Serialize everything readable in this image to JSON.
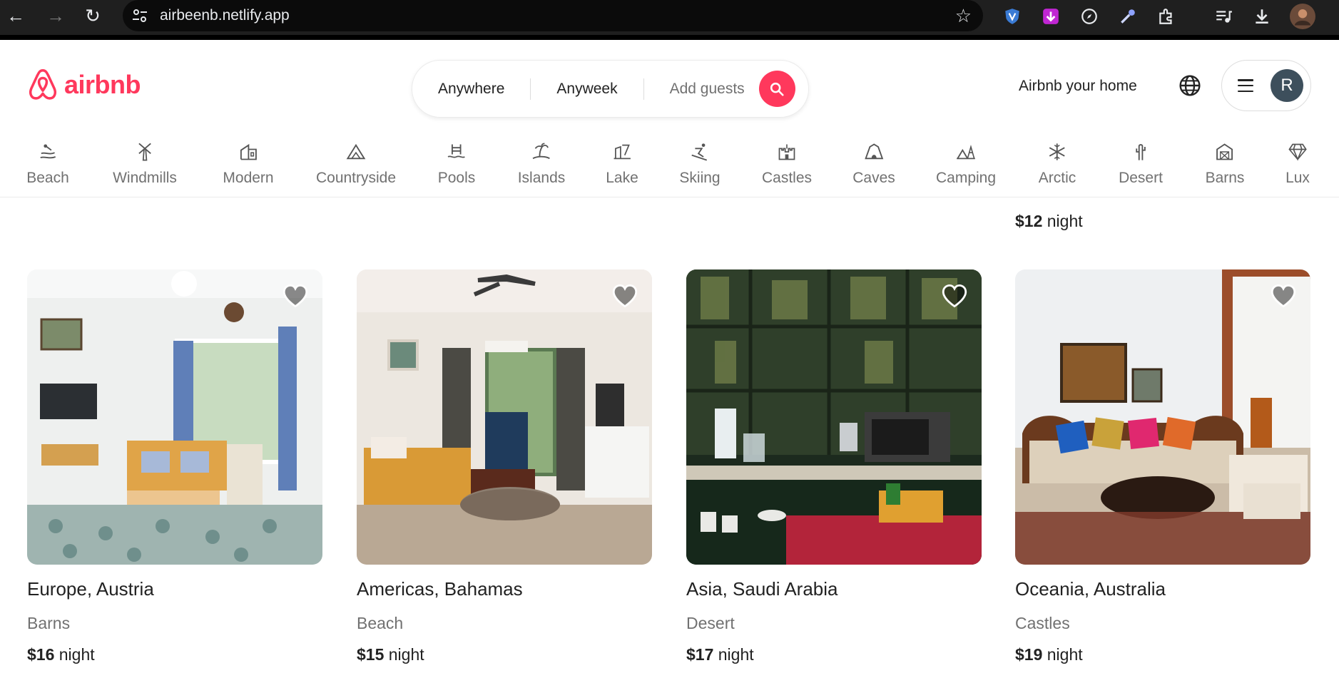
{
  "browser": {
    "url": "airbeenb.netlify.app"
  },
  "header": {
    "brand": "airbnb",
    "search": {
      "where": "Anywhere",
      "when": "Anyweek",
      "guests": "Add guests"
    },
    "host_link": "Airbnb your home",
    "avatar_initial": "R"
  },
  "categories": [
    {
      "label": "Beach",
      "icon": "beach-icon"
    },
    {
      "label": "Windmills",
      "icon": "windmill-icon"
    },
    {
      "label": "Modern",
      "icon": "modern-house-icon"
    },
    {
      "label": "Countryside",
      "icon": "countryside-icon"
    },
    {
      "label": "Pools",
      "icon": "pool-icon"
    },
    {
      "label": "Islands",
      "icon": "island-icon"
    },
    {
      "label": "Lake",
      "icon": "lake-icon"
    },
    {
      "label": "Skiing",
      "icon": "skiing-icon"
    },
    {
      "label": "Castles",
      "icon": "castle-icon"
    },
    {
      "label": "Caves",
      "icon": "cave-icon"
    },
    {
      "label": "Camping",
      "icon": "camping-icon"
    },
    {
      "label": "Arctic",
      "icon": "snowflake-icon"
    },
    {
      "label": "Desert",
      "icon": "cactus-icon"
    },
    {
      "label": "Barns",
      "icon": "barn-icon"
    },
    {
      "label": "Lux",
      "icon": "diamond-icon"
    }
  ],
  "partial_row": {
    "last_price": "$12",
    "night_label": "night"
  },
  "listings": [
    {
      "title": "Europe, Austria",
      "category": "Barns",
      "price": "$16",
      "unit": "night"
    },
    {
      "title": "Americas, Bahamas",
      "category": "Beach",
      "price": "$15",
      "unit": "night"
    },
    {
      "title": "Asia, Saudi Arabia",
      "category": "Desert",
      "price": "$17",
      "unit": "night"
    },
    {
      "title": "Oceania, Australia",
      "category": "Castles",
      "price": "$19",
      "unit": "night"
    }
  ],
  "colors": {
    "brand": "#ff385c",
    "muted": "#717171",
    "text": "#222222"
  }
}
